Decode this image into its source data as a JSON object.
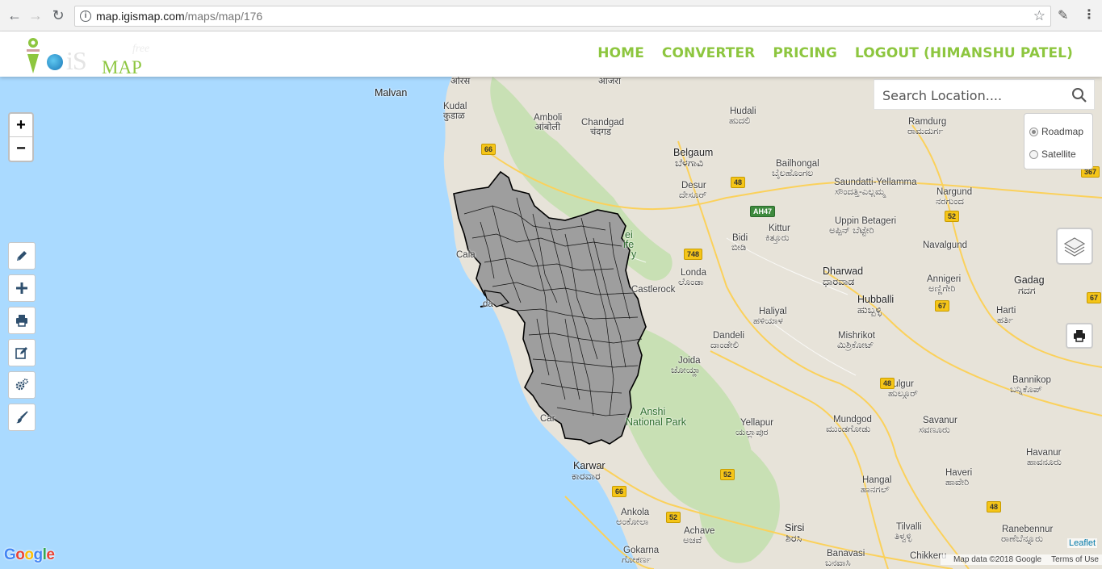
{
  "browser": {
    "url_host": "map.igismap.com",
    "url_path": "/maps/map/176"
  },
  "header": {
    "logo": {
      "left_word": "iS",
      "right_word": "MAP",
      "small_word": "free"
    },
    "nav": [
      {
        "label": "HOME"
      },
      {
        "label": "CONVERTER"
      },
      {
        "label": "PRICING"
      },
      {
        "label": "LOGOUT (HIMANSHU PATEL)"
      }
    ],
    "accent_color": "#8dc63f"
  },
  "map": {
    "search_placeholder": "Search Location....",
    "basemap_options": [
      "Roadmap",
      "Satellite"
    ],
    "basemap_selected": "Roadmap",
    "zoom_in": "+",
    "zoom_out": "−",
    "tools": [
      "pencil-icon",
      "plus-icon",
      "print-icon",
      "edit-icon",
      "settings-icon",
      "brush-icon"
    ],
    "places": {
      "p1": "ओरस",
      "p2": "आजरा",
      "p3": "Malvan",
      "p4": "Kudal",
      "p5": "कुडाळ",
      "p6": "Amboli",
      "p7": "आंबोली",
      "p8": "Chandgad",
      "p9": "चंदगड",
      "p10": "Hudali",
      "p11": "ಹುದಲಿ",
      "p12": "Ramdurg",
      "p13": "ರಾಮದುರ್ಗ",
      "p14": "Belgaum",
      "p15": "ಬೆಳಗಾವಿ",
      "p16": "Bailhongal",
      "p17": "ಬೈಲಹೊಂಗಲ",
      "p18": "Desur",
      "p19": "ದೇಸೂರ್",
      "p20": "Saundatti-Yellamma",
      "p21": "ಸೌಂದತ್ತಿ-ಎಲ್ಲಮ್ಮ",
      "p22": "Nargund",
      "p23": "ನರಗುಂದ",
      "p24": "Kittur",
      "p25": "ಕಿತ್ತೂರು",
      "p26": "Uppin Betageri",
      "p27": "ಅಪ್ಪಿನ್ ಬೆಟ್ಟೇರಿ",
      "p28": "Bidi",
      "p29": "ಬೀಡಿ",
      "p30": "Navalgund",
      "p31": "Londa",
      "p32": "ಲೊಂಡಾ",
      "p33": "Dharwad",
      "p34": "ಧಾರವಾಡ",
      "p35": "Annigeri",
      "p36": "ಅಣ್ಣಿಗೇರಿ",
      "p37": "Gadag",
      "p38": "ಗದಗ",
      "p39": "Castlerock",
      "p40": "Hubballi",
      "p41": "ಹುಬ್ಬಳ್ಳಿ",
      "p42": "Haliyal",
      "p43": "ಹಳಿಯಾಳ",
      "p44": "Harti",
      "p45": "ಹರ್ತಿ",
      "p46": "Dandeli",
      "p47": "ದಾಂಡೇಲಿ",
      "p48": "Mishrikot",
      "p49": "ಮಿಶ್ರಿಕೋಟ್",
      "p50": "Joida",
      "p51": "ಜೋಯ್ಡಾ",
      "p52": "Hulgur",
      "p53": "ಹುಲ್ಗೂರ್",
      "p54": "Bannikop",
      "p55": "ಬನ್ನಿಕೊಪ್",
      "p56": "Anshi",
      "p57": "National Park",
      "p58": "Yellapur",
      "p59": "ಯಲ್ಲಾಪುರ",
      "p60": "Mundgod",
      "p61": "ಮುಂಡಗೋಡು",
      "p62": "Savanur",
      "p63": "ಸವಣೂರು",
      "p64": "Havanur",
      "p65": "ಹಾವನೂರು",
      "p66": "Karwar",
      "p67": "ಕಾರವಾರ",
      "p68": "Haveri",
      "p69": "ಹಾವೇರಿ",
      "p70": "Hangal",
      "p71": "ಹಾನಗಲ್",
      "p72": "Ankola",
      "p73": "ಅಂಕೋಲಾ",
      "p74": "Achave",
      "p75": "ಅಚವೆ",
      "p76": "Sirsi",
      "p77": "ಶಿರಸಿ",
      "p78": "Tilvalli",
      "p79": "ತಿಳ್ವಳ್ಳಿ",
      "p80": "Ranebennur",
      "p81": "ರಾಣೆಬೆನ್ನೂರು",
      "p82": "Gokarna",
      "p83": "ಗೋಕರ್ಣ",
      "p84": "Banavasi",
      "p85": "ಬನವಾಸಿ",
      "p86": "Chikkeru",
      "p87": "Cala",
      "p88": "da",
      "p89": "Car",
      "p90": "ei",
      "p91": "ife",
      "p92": "y"
    },
    "shields": {
      "s1": "66",
      "s2": "48",
      "s3": "AH47",
      "s4": "748",
      "s5": "52",
      "s6": "67",
      "s7": "48",
      "s8": "66",
      "s9": "52",
      "s10": "52",
      "s11": "48",
      "s12": "367",
      "s13": "67"
    },
    "google_logo": [
      "G",
      "o",
      "o",
      "g",
      "l",
      "e"
    ],
    "google_colors": [
      "#4285f4",
      "#ea4335",
      "#fbbc05",
      "#4285f4",
      "#34a853",
      "#ea4335"
    ],
    "leaflet_attr": "Leaflet",
    "map_data": "Map data ©2018 Google",
    "terms": "Terms of Use"
  }
}
